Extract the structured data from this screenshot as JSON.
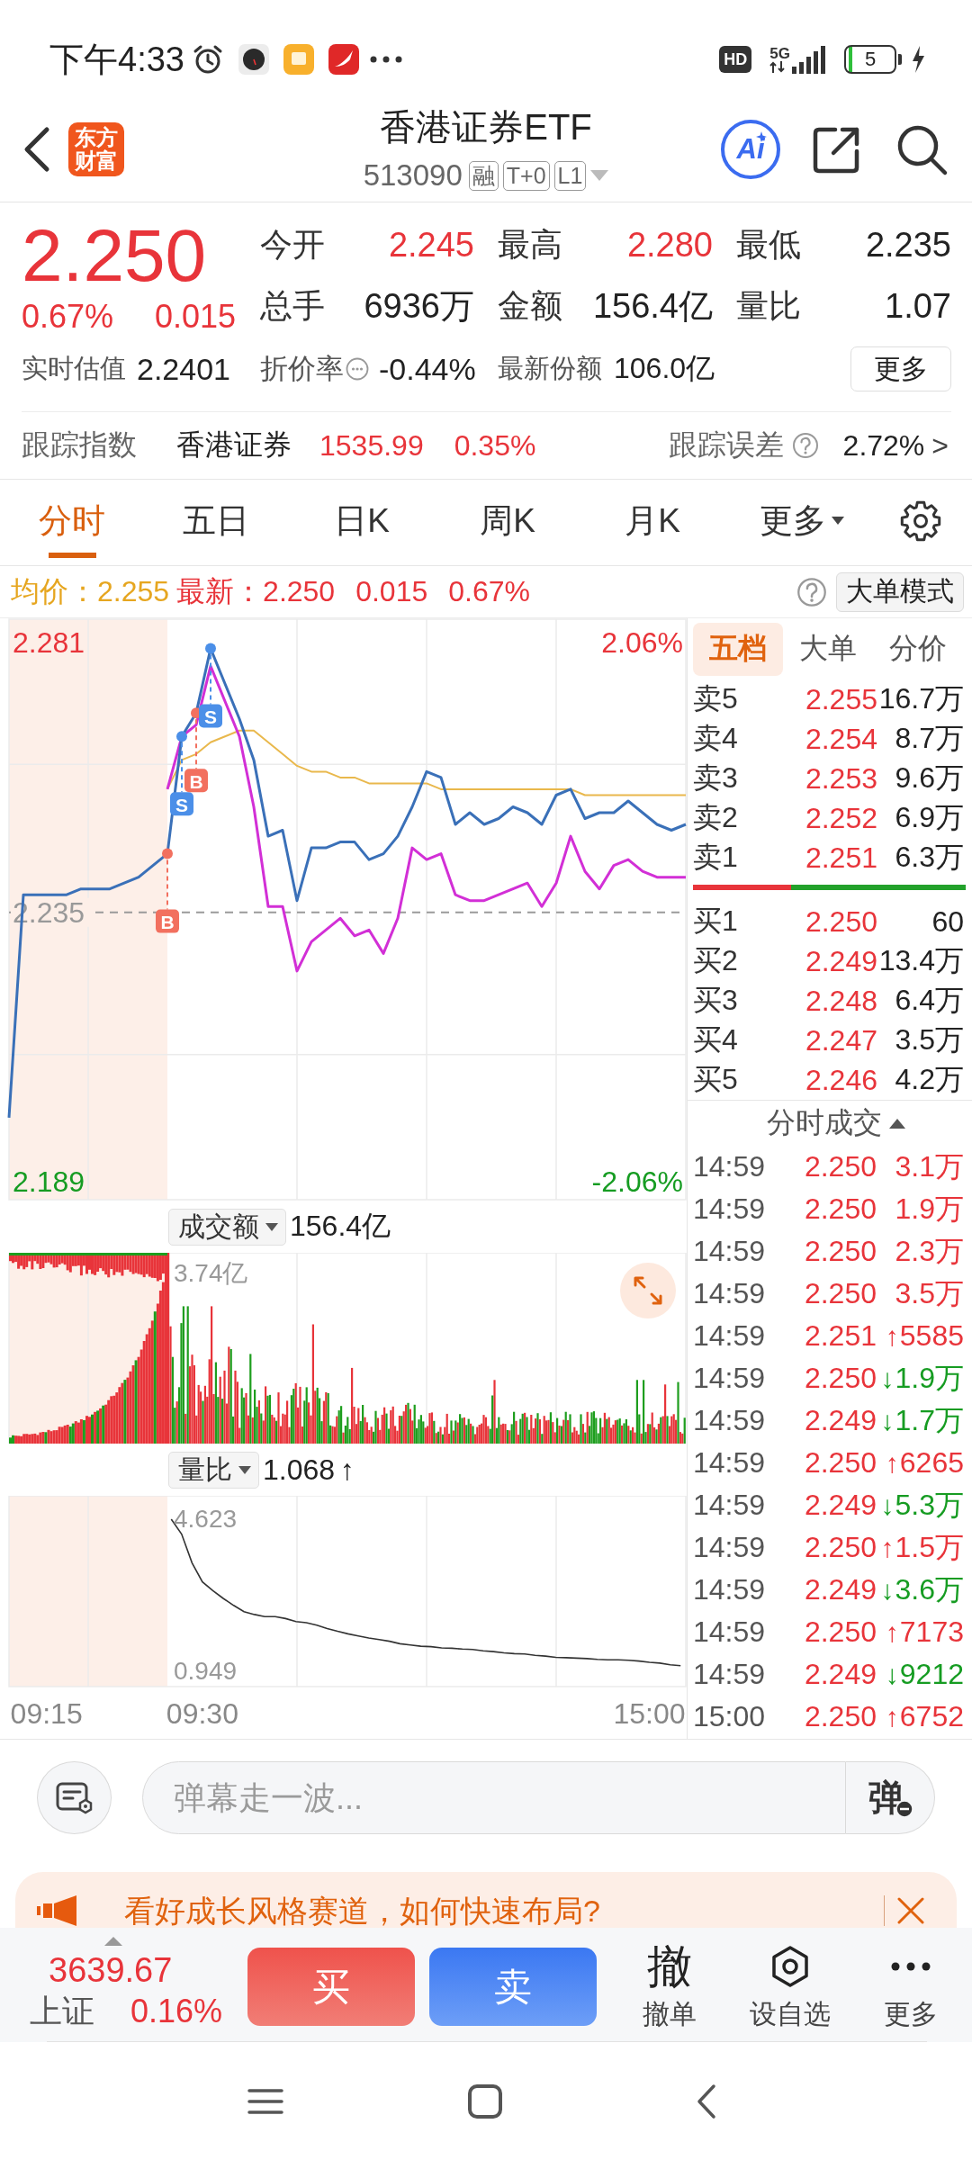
{
  "status_bar": {
    "time": "下午4:33",
    "hd_badge": "HD",
    "network": "5G",
    "battery": "5"
  },
  "header": {
    "logo": "东方财富",
    "title": "香港证券ETF",
    "code": "513090",
    "badges": [
      "融",
      "T+0",
      "L1"
    ],
    "ai_button": "Ai"
  },
  "quote": {
    "price": "2.250",
    "change_pct": "0.67%",
    "change": "0.015",
    "stats": [
      {
        "label": "今开",
        "value": "2.245",
        "color": "#e8343a"
      },
      {
        "label": "最高",
        "value": "2.280",
        "color": "#e8343a"
      },
      {
        "label": "最低",
        "value": "2.235",
        "color": "#222222"
      },
      {
        "label": "总手",
        "value": "6936万",
        "color": "#222222"
      },
      {
        "label": "金额",
        "value": "156.4亿",
        "color": "#222222"
      },
      {
        "label": "量比",
        "value": "1.07",
        "color": "#222222"
      }
    ],
    "estimate": {
      "label": "实时估值",
      "value": "2.2401"
    },
    "discount": {
      "label": "折价率",
      "value": "-0.44%"
    },
    "shares": {
      "label": "最新份额",
      "value": "106.0亿"
    },
    "more_button": "更多"
  },
  "tracking": {
    "label": "跟踪指数",
    "index_name": "香港证券",
    "index_value": "1535.99",
    "index_change": "0.35%",
    "error_label": "跟踪误差",
    "error_value": "2.72%",
    "chevron": ">"
  },
  "chart_tabs": [
    {
      "label": "分时",
      "selected": true,
      "dropdown": false
    },
    {
      "label": "五日",
      "selected": false,
      "dropdown": false
    },
    {
      "label": "日K",
      "selected": false,
      "dropdown": false
    },
    {
      "label": "周K",
      "selected": false,
      "dropdown": false
    },
    {
      "label": "月K",
      "selected": false,
      "dropdown": false
    },
    {
      "label": "更多",
      "selected": false,
      "dropdown": true
    }
  ],
  "info_row": {
    "average": "均价：2.255",
    "latest": "最新：2.250",
    "change": "0.015",
    "change_pct": "0.67%",
    "mode_button": "大单模式"
  },
  "price_chart": {
    "percent_labels": [
      "2.06%",
      "-2.06%"
    ],
    "markers": [
      {
        "kind": "buy"
      },
      {
        "kind": "sell"
      },
      {
        "kind": "buy"
      },
      {
        "kind": "sell"
      }
    ],
    "chart_data": {
      "type": "line",
      "categories": [
        null,
        null,
        null,
        null,
        null,
        null,
        null,
        null,
        null,
        null,
        null,
        null,
        null,
        null,
        null,
        null,
        null,
        null,
        null,
        null,
        null,
        null,
        null,
        null,
        null,
        null,
        null,
        null,
        null,
        null,
        null,
        null,
        null,
        null,
        null,
        null,
        null,
        null,
        null,
        null,
        null,
        null,
        null,
        null,
        null,
        null,
        null,
        null
      ],
      "ylim": [
        2.186,
        2.285
      ],
      "yticks": [
        2.281,
        2.235,
        2.189
      ],
      "grid": true,
      "ref_lines": [
        {
          "axis": "y",
          "value": 2.235
        }
      ],
      "series": [
        {
          "color": "#3a70b8",
          "values": [
            2.2,
            2.238,
            2.238,
            2.238,
            2.238,
            2.239,
            2.239,
            2.239,
            2.24,
            2.241,
            2.243,
            2.245,
            2.265,
            2.269,
            2.28,
            2.274,
            2.268,
            2.261,
            2.248,
            2.249,
            2.237,
            2.246,
            2.246,
            2.247,
            2.247,
            2.244,
            2.245,
            2.248,
            2.253,
            2.259,
            2.258,
            2.25,
            2.252,
            2.25,
            2.251,
            2.253,
            2.252,
            2.25,
            2.255,
            2.256,
            2.251,
            2.252,
            2.252,
            2.254,
            2.252,
            2.25,
            2.249,
            2.25
          ]
        },
        {
          "color": "#d22fd6",
          "values": [
            null,
            null,
            null,
            null,
            null,
            null,
            null,
            null,
            null,
            null,
            null,
            2.256,
            2.265,
            2.267,
            2.277,
            2.271,
            2.265,
            2.253,
            2.236,
            2.236,
            2.225,
            2.23,
            2.232,
            2.234,
            2.231,
            2.232,
            2.228,
            2.234,
            2.246,
            2.244,
            2.245,
            2.238,
            2.237,
            2.237,
            2.238,
            2.239,
            2.24,
            2.236,
            2.24,
            2.248,
            2.242,
            2.239,
            2.243,
            2.244,
            2.242,
            2.241,
            2.241,
            2.241
          ]
        },
        {
          "color": "#e9b84c",
          "values": [
            null,
            null,
            null,
            null,
            null,
            null,
            null,
            null,
            null,
            null,
            null,
            2.256,
            2.261,
            2.262,
            2.264,
            2.265,
            2.266,
            2.266,
            2.264,
            2.262,
            2.26,
            2.259,
            2.259,
            2.258,
            2.258,
            2.257,
            2.257,
            2.257,
            2.257,
            2.257,
            2.256,
            2.256,
            2.256,
            2.256,
            2.256,
            2.256,
            2.256,
            2.256,
            2.256,
            2.256,
            2.255,
            2.255,
            2.255,
            2.255,
            2.255,
            2.255,
            2.255,
            2.255
          ]
        }
      ],
      "annotations": [
        {
          "text": "B",
          "y": 2.245
        },
        {
          "text": "S",
          "y": 2.265
        },
        {
          "text": "B",
          "y": 2.269
        },
        {
          "text": "S",
          "y": 2.28
        }
      ]
    }
  },
  "volume_chart": {
    "metric": "成交额",
    "total": "156.4亿",
    "max_label": "3.74亿"
  },
  "ratio_chart": {
    "metric": "量比",
    "value": "1.068",
    "arrow": "↑",
    "chart_data": {
      "type": "line",
      "categories": [
        null,
        null,
        null,
        "09:15",
        null,
        null,
        null,
        null,
        null,
        null,
        null,
        null,
        null,
        null,
        null,
        null,
        null,
        null,
        "09:30",
        null,
        null,
        null,
        null,
        null,
        null,
        null,
        null,
        null,
        null,
        null,
        null,
        null,
        null,
        null,
        null,
        null,
        null,
        null,
        null,
        null,
        null,
        null,
        null,
        null,
        null,
        null,
        null,
        null,
        null,
        null,
        null,
        null,
        null,
        null,
        null,
        null,
        null,
        null,
        null,
        null,
        null,
        "15:00",
        null,
        null,
        null
      ],
      "ylim": [
        0.56,
        5.19
      ],
      "yticks": [
        4.623,
        0.949
      ],
      "grid": true,
      "series": [
        {
          "color": "#333333",
          "values": [
            null,
            null,
            null,
            null,
            null,
            null,
            null,
            null,
            null,
            null,
            null,
            null,
            null,
            null,
            null,
            4.623,
            4.26,
            3.56,
            3.1,
            2.89,
            2.7,
            2.53,
            2.38,
            2.31,
            2.26,
            2.26,
            2.21,
            2.14,
            2.11,
            2.05,
            1.97,
            1.9,
            1.84,
            1.79,
            1.74,
            1.7,
            1.66,
            1.6,
            1.57,
            1.54,
            1.53,
            1.5,
            1.49,
            1.47,
            1.46,
            1.43,
            1.41,
            1.38,
            1.36,
            1.35,
            1.32,
            1.3,
            1.27,
            1.26,
            1.25,
            1.24,
            1.22,
            1.21,
            1.21,
            1.2,
            1.18,
            1.15,
            1.13,
            1.09,
            1.068
          ]
        }
      ]
    }
  },
  "order_book": {
    "tabs": [
      {
        "label": "五档",
        "selected": true
      },
      {
        "label": "大单",
        "selected": false
      },
      {
        "label": "分价",
        "selected": false
      }
    ],
    "asks": [
      {
        "label": "卖5",
        "price": "2.255",
        "volume": "16.7万"
      },
      {
        "label": "卖4",
        "price": "2.254",
        "volume": "8.7万"
      },
      {
        "label": "卖3",
        "price": "2.253",
        "volume": "9.6万"
      },
      {
        "label": "卖2",
        "price": "2.252",
        "volume": "6.9万"
      },
      {
        "label": "卖1",
        "price": "2.251",
        "volume": "6.3万"
      }
    ],
    "balance": {
      "level": 0.36
    },
    "bids": [
      {
        "label": "买1",
        "price": "2.250",
        "volume": "60"
      },
      {
        "label": "买2",
        "price": "2.249",
        "volume": "13.4万"
      },
      {
        "label": "买3",
        "price": "2.248",
        "volume": "6.4万"
      },
      {
        "label": "买4",
        "price": "2.247",
        "volume": "3.5万"
      },
      {
        "label": "买5",
        "price": "2.246",
        "volume": "4.2万"
      }
    ]
  },
  "trades": {
    "title": "分时成交",
    "rows": [
      {
        "time": "14:59",
        "price": "2.250",
        "volume": "3.1万",
        "color": "#e8343a"
      },
      {
        "time": "14:59",
        "price": "2.250",
        "volume": "1.9万",
        "color": "#e8343a"
      },
      {
        "time": "14:59",
        "price": "2.250",
        "volume": "2.3万",
        "color": "#e8343a"
      },
      {
        "time": "14:59",
        "price": "2.250",
        "volume": "3.5万",
        "color": "#e8343a"
      },
      {
        "time": "14:59",
        "price": "2.251",
        "arrow": "↑",
        "volume": "5585",
        "color": "#e8343a"
      },
      {
        "time": "14:59",
        "price": "2.250",
        "arrow": "↓",
        "volume": "1.9万",
        "color": "#169c22"
      },
      {
        "time": "14:59",
        "price": "2.249",
        "arrow": "↓",
        "volume": "1.7万",
        "color": "#169c22"
      },
      {
        "time": "14:59",
        "price": "2.250",
        "arrow": "↑",
        "volume": "6265",
        "color": "#e8343a"
      },
      {
        "time": "14:59",
        "price": "2.249",
        "arrow": "↓",
        "volume": "5.3万",
        "color": "#169c22"
      },
      {
        "time": "14:59",
        "price": "2.250",
        "arrow": "↑",
        "volume": "1.5万",
        "color": "#e8343a"
      },
      {
        "time": "14:59",
        "price": "2.249",
        "arrow": "↓",
        "volume": "3.6万",
        "color": "#169c22"
      },
      {
        "time": "14:59",
        "price": "2.250",
        "arrow": "↑",
        "volume": "7173",
        "color": "#e8343a"
      },
      {
        "time": "14:59",
        "price": "2.249",
        "arrow": "↓",
        "volume": "9212",
        "color": "#169c22"
      },
      {
        "time": "15:00",
        "price": "2.250",
        "arrow": "↑",
        "volume": "6752",
        "color": "#e8343a"
      }
    ]
  },
  "comment": {
    "placeholder": "弹幕走一波...",
    "danmaku_button": "弹"
  },
  "banner": {
    "text": "看好成长风格赛道，如何快速布局?"
  },
  "trade_bar": {
    "index_value": "3639.67",
    "index_name": "上证",
    "index_change": "0.16%",
    "buy": "买",
    "sell": "卖",
    "actions": [
      {
        "kind": "glyph",
        "glyph": "撤",
        "label": "撤单"
      },
      {
        "kind": "watch",
        "label": "设自选"
      },
      {
        "kind": "more",
        "label": "更多"
      }
    ]
  }
}
